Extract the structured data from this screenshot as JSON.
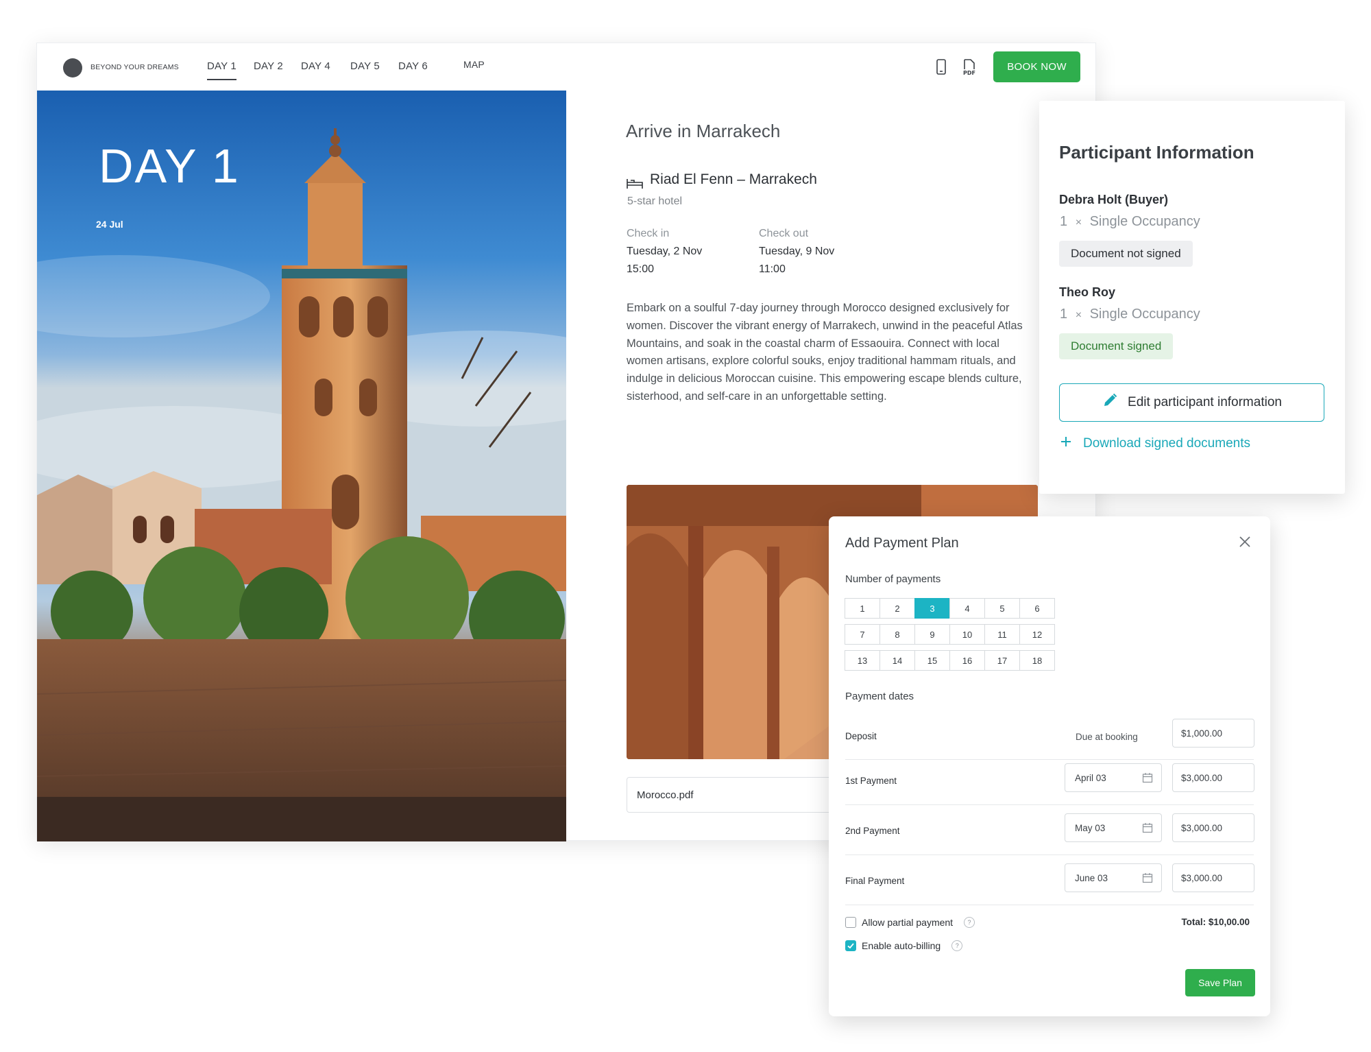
{
  "brand": {
    "name": "BEYOND YOUR DREAMS"
  },
  "nav": {
    "tabs": [
      "DAY 1",
      "DAY 2",
      "DAY 4",
      "DAY 5",
      "DAY 6"
    ],
    "map_label": "MAP",
    "active_tab": "DAY 1",
    "icons": [
      "mobile-icon",
      "pdf-icon"
    ],
    "pdf_icon_text": "PDF",
    "book_now_label": "BOOK NOW"
  },
  "hero": {
    "day_label": "DAY 1",
    "date": "24 Jul"
  },
  "content": {
    "title": "Arrive in Marrakech",
    "hotel_name": "Riad El Fenn – Marrakech",
    "hotel_category": "5-star hotel",
    "check_in_label": "Check in",
    "check_in_date": "Tuesday, 2 Nov",
    "check_in_time": "15:00",
    "check_out_label": "Check out",
    "check_out_date": "Tuesday, 9 Nov",
    "check_out_time": "11:00",
    "description": "Embark on a soulful 7-day journey through Morocco designed exclusively for women. Discover the vibrant energy of Marrakech, unwind in the peaceful Atlas Mountains, and soak in the coastal charm of Essaouira. Connect with local women artisans, explore colorful souks, enjoy traditional hammam rituals, and indulge in delicious Moroccan cuisine. This empowering escape blends culture, sisterhood, and self-care in an unforgettable setting.",
    "attachment": "Morocco.pdf"
  },
  "participants": {
    "title": "Participant Information",
    "people": [
      {
        "name": "Debra Holt (Buyer)",
        "qty": "1",
        "times": "×",
        "occupancy": "Single Occupancy",
        "status": "Document not signed"
      },
      {
        "name": "Theo Roy",
        "qty": "1",
        "times": "×",
        "occupancy": "Single Occupancy",
        "status": "Document signed"
      }
    ],
    "edit_label": "Edit participant information",
    "download_label": "Download signed documents"
  },
  "payment_plan": {
    "title": "Add Payment Plan",
    "number_label": "Number of payments",
    "numbers": [
      "1",
      "2",
      "3",
      "4",
      "5",
      "6",
      "7",
      "8",
      "9",
      "10",
      "11",
      "12",
      "13",
      "14",
      "15",
      "16",
      "17",
      "18"
    ],
    "selected_number": "3",
    "dates_label": "Payment dates",
    "rows": [
      {
        "label": "Deposit",
        "date": "Due at booking",
        "amount": "$1,000.00"
      },
      {
        "label": "1st Payment",
        "date": "April 03",
        "amount": "$3,000.00"
      },
      {
        "label": "2nd Payment",
        "date": "May 03",
        "amount": "$3,000.00"
      },
      {
        "label": "Final Payment",
        "date": "June 03",
        "amount": "$3,000.00"
      }
    ],
    "allow_partial_label": "Allow partial payment",
    "allow_partial_checked": false,
    "auto_billing_label": "Enable auto-billing",
    "auto_billing_checked": true,
    "help_glyph": "?",
    "total": "Total: $10,00.00",
    "save_label": "Save Plan"
  },
  "colors": {
    "accent": "#1cb4c4",
    "brand_green": "#2fae4d"
  }
}
